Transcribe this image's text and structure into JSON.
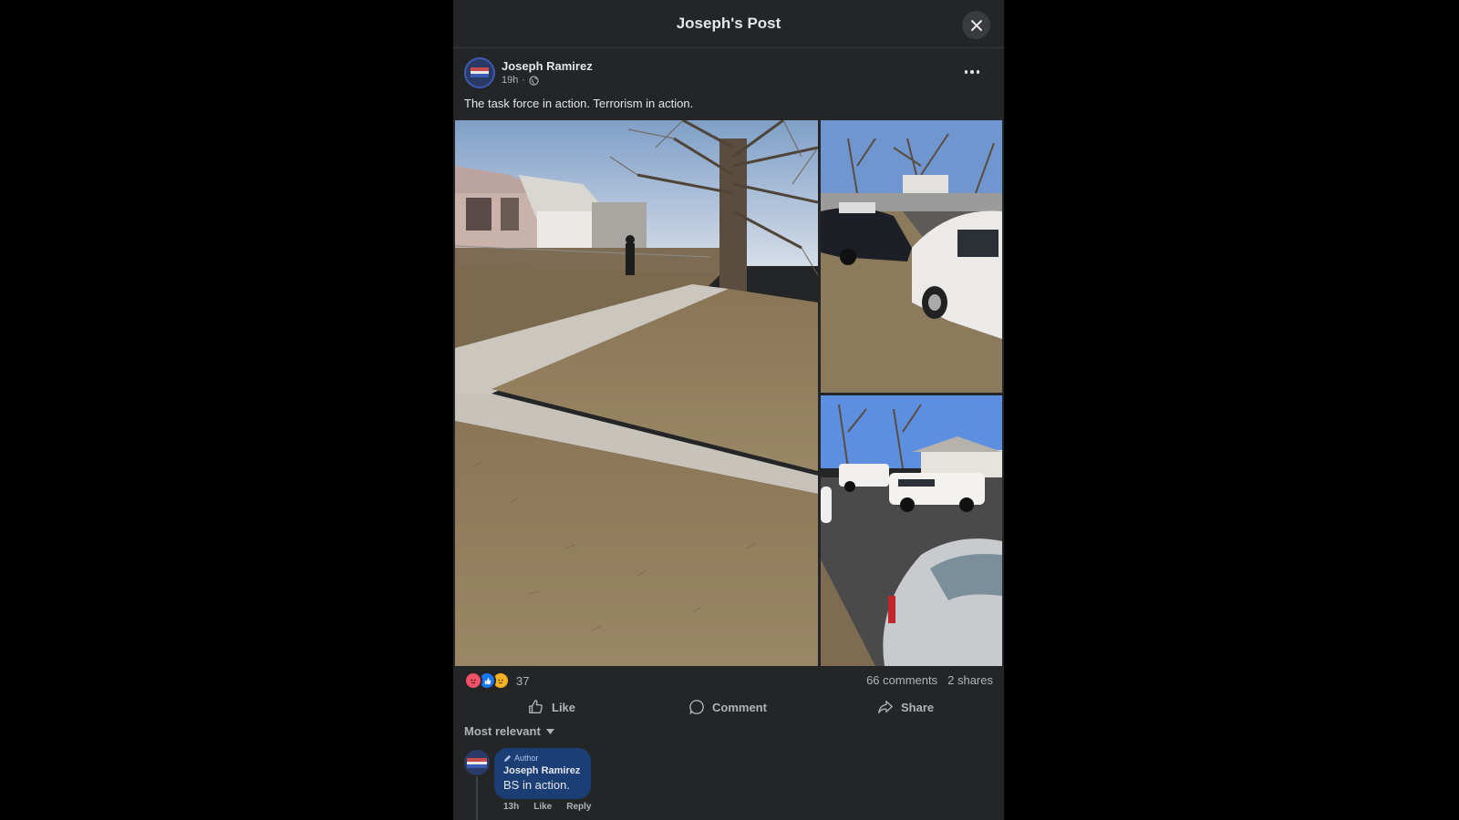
{
  "dialog": {
    "title": "Joseph's Post",
    "close_icon": "close-icon"
  },
  "post": {
    "author": "Joseph Ramirez",
    "time": "19h",
    "privacy_icon": "globe-icon",
    "text": "The task force in action. Terrorism in action.",
    "photos": [
      {
        "name": "photo-front-yard",
        "icon": "photo"
      },
      {
        "name": "photo-street-cars",
        "icon": "photo"
      },
      {
        "name": "photo-sheriff-vehicles",
        "icon": "photo"
      }
    ]
  },
  "stats": {
    "reactions": [
      "angry",
      "like",
      "sad"
    ],
    "reaction_count": "37",
    "comments": "66 comments",
    "shares": "2 shares"
  },
  "actions": {
    "like": "Like",
    "comment": "Comment",
    "share": "Share"
  },
  "comments": {
    "sort_label": "Most relevant",
    "items": [
      {
        "badge": "Author",
        "name": "Joseph Ramirez",
        "text": "BS in action.",
        "time": "13h",
        "like": "Like",
        "reply": "Reply"
      }
    ]
  },
  "colors": {
    "panel": "#242526",
    "bubble": "#1b3f75",
    "text": "#e4e6eb",
    "muted": "#b0b3b8",
    "like_blue": "#1877f2",
    "angry": "#f25268",
    "sad": "#f7b125"
  }
}
